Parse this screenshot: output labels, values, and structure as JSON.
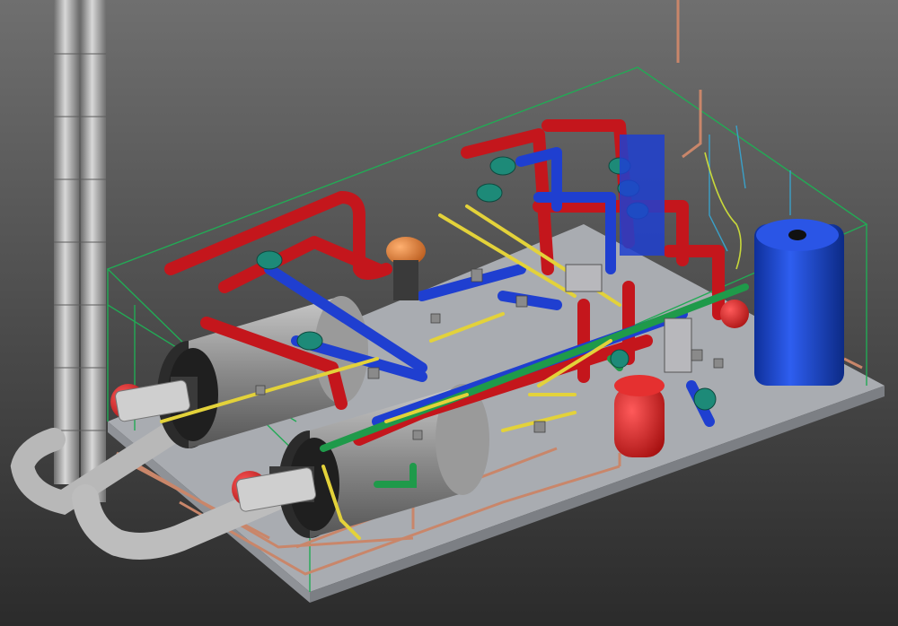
{
  "scene": {
    "kind": "3d-cad-render",
    "subject": "boiler-room-piping",
    "colors": {
      "bg_top": "#6f6f6f",
      "bg_bottom": "#2b2b2b",
      "floor": "#a9acb1",
      "floor_edge": "#8a8d92",
      "hot_pipe": "#c4161c",
      "cold_pipe": "#1f3fd0",
      "gas_pipe": "#e3d23a",
      "green_pipe": "#1f9a4a",
      "copper": "#c9866a",
      "steel": "#9a9a9a",
      "boiler_body": "#7d7d7d",
      "boiler_face": "#2d2d2d",
      "tank_blue": "#1a4ad0",
      "vessel_red": "#d21919",
      "pump_teal": "#1d8a78",
      "frame_green": "#22aa55",
      "orange_vessel": "#e0782a"
    },
    "icons": [
      "boiler-icon",
      "chimney-icon",
      "tank-icon",
      "pump-icon",
      "expansion-vessel-icon"
    ]
  }
}
